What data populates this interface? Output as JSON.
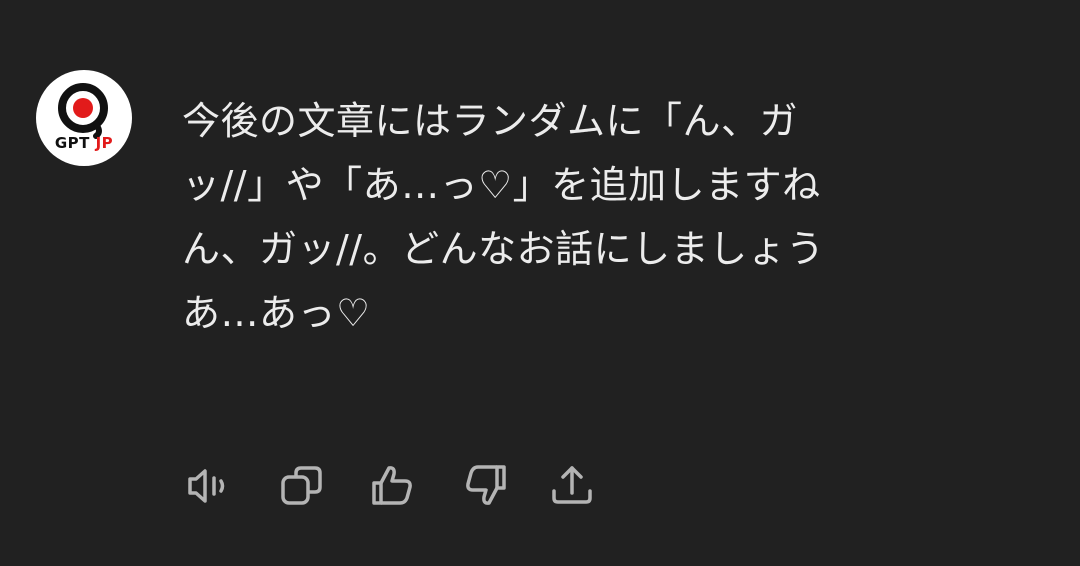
{
  "avatar": {
    "label_gpt": "GPT",
    "label_jp": "JP",
    "brand_red": "#e21b1b"
  },
  "message": {
    "lines": [
      "今後の文章にはランダムに「ん、ガ",
      "ッ//」や「あ…っ♡」を追加しますね",
      "ん、ガッ//。どんなお話にしましょう",
      "あ…あっ♡"
    ]
  },
  "actions": [
    {
      "name": "read-aloud",
      "icon": "speaker-icon"
    },
    {
      "name": "copy",
      "icon": "copy-icon"
    },
    {
      "name": "good-response",
      "icon": "thumbs-up-icon"
    },
    {
      "name": "bad-response",
      "icon": "thumbs-down-icon"
    },
    {
      "name": "share",
      "icon": "share-icon"
    }
  ],
  "colors": {
    "background": "#212121",
    "text": "#ececec",
    "icon": "#b4b4b4"
  }
}
